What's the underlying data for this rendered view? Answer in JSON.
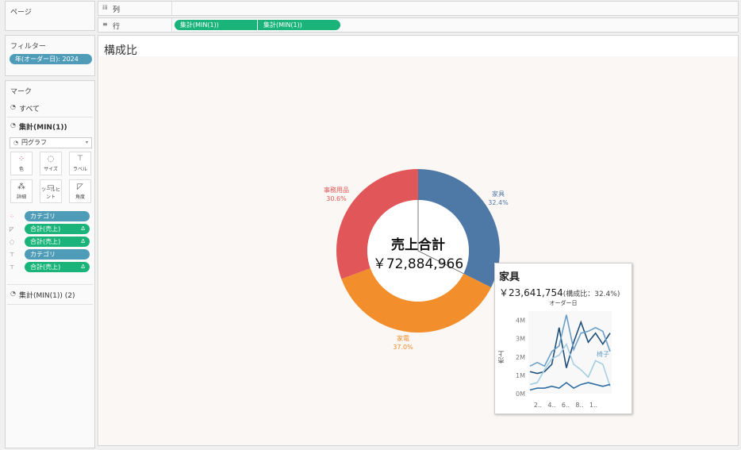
{
  "pages_shelf": {
    "title": "ページ"
  },
  "columns_shelf": {
    "icon": "iii",
    "label": "列"
  },
  "rows_shelf": {
    "icon": "≡",
    "label": "行",
    "pills": [
      "集計(MIN(1))",
      "集計(MIN(1))"
    ]
  },
  "filters": {
    "title": "フィルター",
    "pills": [
      "年(オーダー日): 2024"
    ]
  },
  "marks": {
    "title": "マーク",
    "all_label": "すべて",
    "section_label": "集計(MIN(1))",
    "mark_type": "円グラフ",
    "cards": [
      {
        "label": "色",
        "icon": "color-icon"
      },
      {
        "label": "サイズ",
        "icon": "size-icon"
      },
      {
        "label": "ラベル",
        "icon": "label-icon"
      },
      {
        "label": "詳細",
        "icon": "detail-icon"
      },
      {
        "label": "ツールヒント",
        "icon": "tooltip-icon"
      },
      {
        "label": "角度",
        "icon": "angle-icon"
      }
    ],
    "fields": [
      {
        "label": "カテゴリ",
        "type": "dimension",
        "delta": ""
      },
      {
        "label": "合計(売上)",
        "type": "measure",
        "delta": "Δ"
      },
      {
        "label": "合計(売上)",
        "type": "measure",
        "delta": "Δ"
      },
      {
        "label": "カテゴリ",
        "type": "dimension",
        "delta": ""
      },
      {
        "label": "合計(売上)",
        "type": "measure",
        "delta": "Δ"
      }
    ],
    "second_section_label": "集計(MIN(1)) (2)"
  },
  "sheet": {
    "title": "構成比"
  },
  "chart_data": [
    {
      "type": "pie",
      "slices": [
        {
          "name": "家具",
          "percent": 32.4,
          "color": "#4e79a7"
        },
        {
          "name": "家電",
          "percent": 37.0,
          "color": "#f28e2b"
        },
        {
          "name": "事務用品",
          "percent": 30.6,
          "color": "#e15759"
        }
      ],
      "center_label": "売上合計",
      "center_value": "￥72,884,966"
    },
    {
      "type": "line",
      "title": "オーダー日",
      "ylabel": "売上",
      "y_ticks": [
        "0M",
        "1M",
        "2M",
        "3M",
        "4M"
      ],
      "x_ticks": [
        "2..",
        "4..",
        "6..",
        "8..",
        "1.."
      ],
      "ylim": [
        0,
        4.5
      ],
      "x": [
        1,
        2,
        3,
        4,
        5,
        6,
        7,
        8,
        9,
        10,
        11,
        12
      ],
      "annotation": "椅子",
      "series": [
        {
          "color": "#1f4e79",
          "values": [
            1.2,
            1.1,
            1.2,
            1.6,
            3.6,
            1.4,
            2.8,
            3.9,
            2.8,
            3.3,
            2.7,
            3.3
          ]
        },
        {
          "color": "#6a9fc8",
          "values": [
            1.5,
            1.7,
            1.5,
            2.3,
            2.6,
            4.3,
            2.4,
            3.3,
            3.4,
            3.6,
            3.4,
            2.3
          ]
        },
        {
          "color": "#a6cee3",
          "values": [
            0.5,
            0.6,
            1.3,
            1.9,
            2.1,
            2.7,
            1.6,
            1.3,
            0.9,
            1.8,
            1.6,
            0.4
          ]
        },
        {
          "color": "#2e6da4",
          "values": [
            0.2,
            0.3,
            0.3,
            0.4,
            0.3,
            0.6,
            0.3,
            0.5,
            0.6,
            0.5,
            0.4,
            0.5
          ]
        }
      ]
    }
  ],
  "tooltip": {
    "category": "家具",
    "sales_value": "￥23,641,754",
    "share_text": "(構成比：32.4%)"
  }
}
